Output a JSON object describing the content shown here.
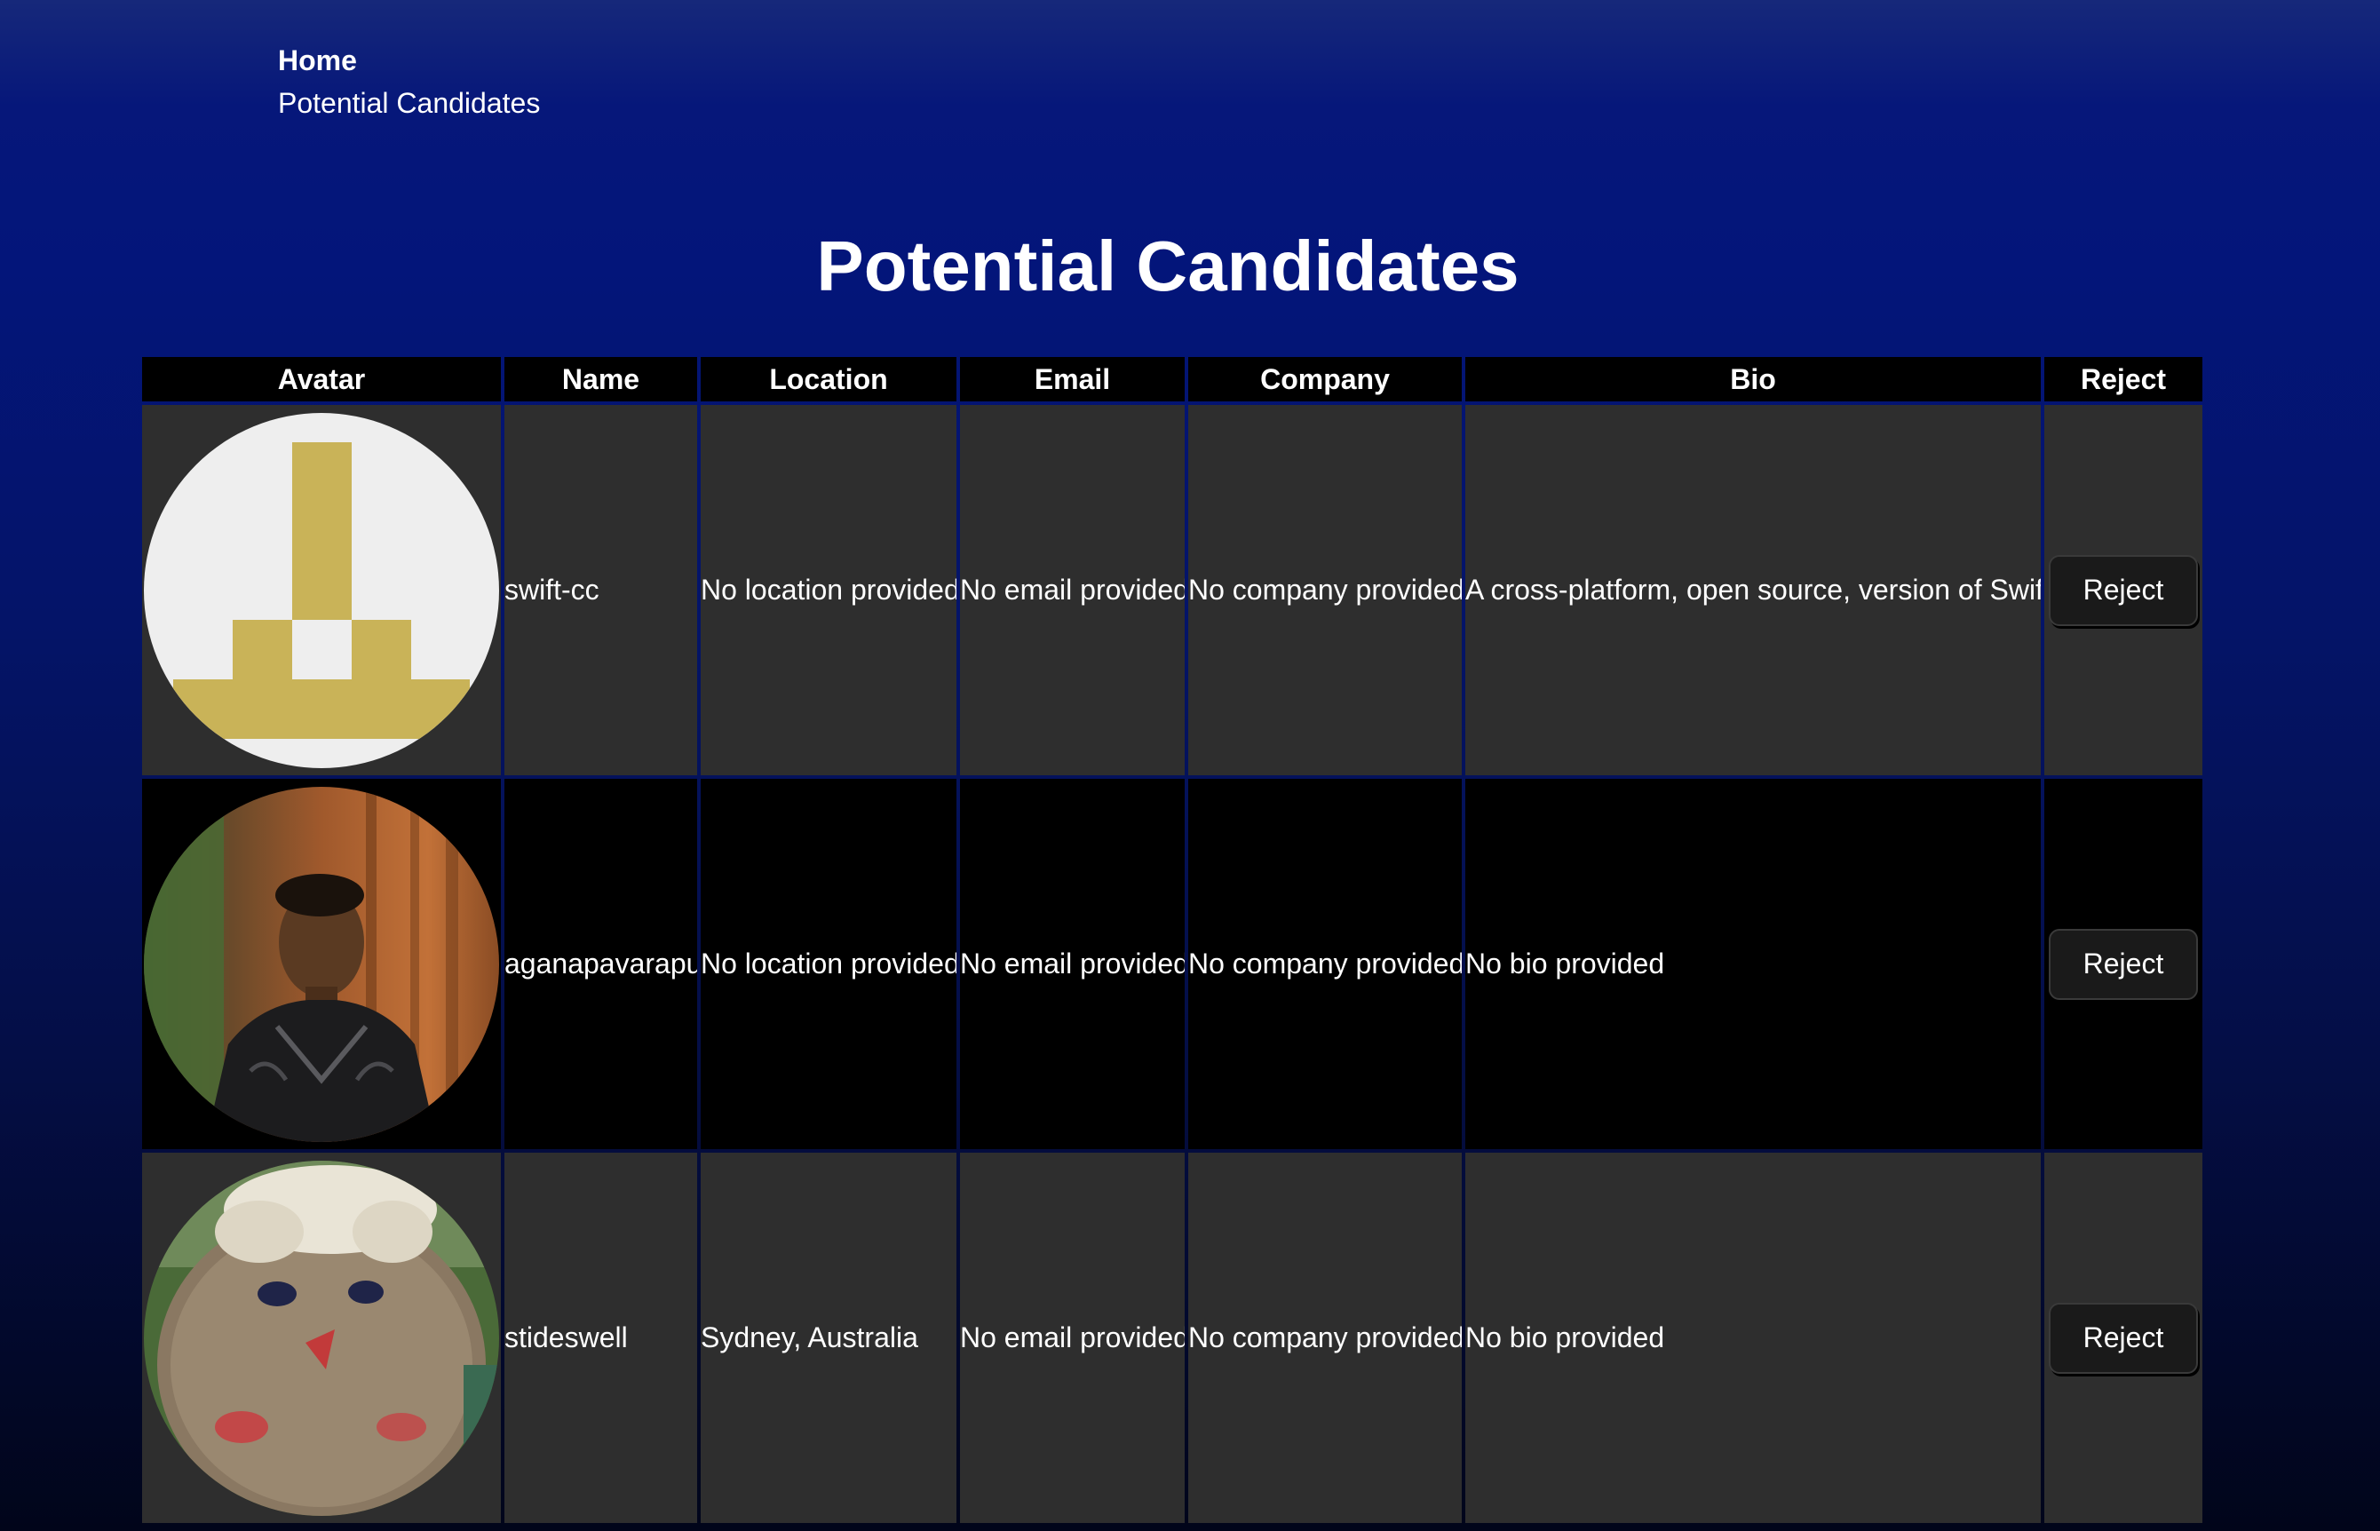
{
  "nav": {
    "home_label": "Home",
    "candidates_label": "Potential Candidates"
  },
  "page_title": "Potential Candidates",
  "table": {
    "headers": {
      "avatar": "Avatar",
      "name": "Name",
      "location": "Location",
      "email": "Email",
      "company": "Company",
      "bio": "Bio",
      "reject": "Reject"
    },
    "rows": [
      {
        "avatar_icon": "identicon-avatar",
        "name": "swift-cc",
        "location": "No location provided",
        "email": "No email provided",
        "company": "No company provided",
        "bio": "A cross-platform, open source, version of Swift",
        "reject_label": "Reject"
      },
      {
        "avatar_icon": "photo-avatar-man",
        "name": "aganapavarapu",
        "location": "No location provided",
        "email": "No email provided",
        "company": "No company provided",
        "bio": "No bio provided",
        "reject_label": "Reject"
      },
      {
        "avatar_icon": "photo-avatar-knitted-doll",
        "name": "stideswell",
        "location": "Sydney, Australia",
        "email": "No email provided",
        "company": "No company provided",
        "bio": "No bio provided",
        "reject_label": "Reject"
      }
    ]
  },
  "colors": {
    "background_top": "#16287a",
    "background_bottom": "#01051a",
    "row_odd": "#2e2e2e",
    "row_even": "#000000",
    "identicon_gold": "#c9b358",
    "identicon_bg": "#eeeeee"
  }
}
